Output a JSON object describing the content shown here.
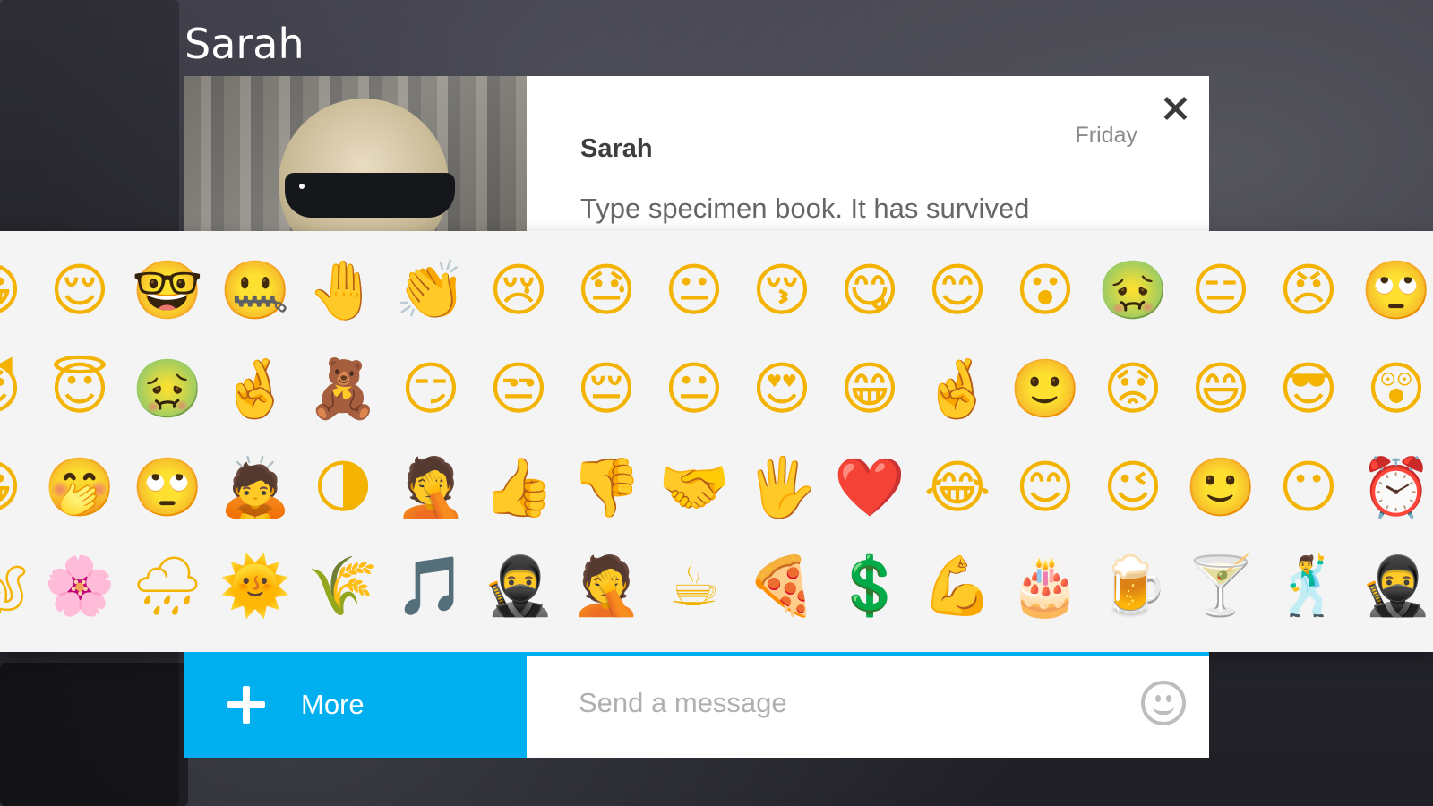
{
  "header": {
    "contact_name": "Sarah"
  },
  "conversation": {
    "sender": "Sarah",
    "time": "Friday",
    "preview_text": "Type specimen book. It has survived"
  },
  "emoji_picker": {
    "rows": [
      [
        "😀",
        "😌",
        "🤓",
        "🤐",
        "🤚",
        "👏",
        "😢",
        "😓",
        "😐",
        "😚",
        "😋",
        "😊",
        "😮",
        "🤢",
        "😑",
        "😠",
        "🙄"
      ],
      [
        "😈",
        "😇",
        "🤢",
        "🤞",
        "🧸",
        "😏",
        "😒",
        "😔",
        "😐",
        "😍",
        "😁",
        "🤞",
        "🙂",
        "😟",
        "😄",
        "😎",
        "😲"
      ],
      [
        "😀",
        "🤭",
        "🙄",
        "🙇",
        "🌗",
        "🤦",
        "👍",
        "👎",
        "🤝",
        "🖐",
        "❤️",
        "😂",
        "😊",
        "😉",
        "🙂",
        "😶",
        "⏰"
      ],
      [
        "🐿",
        "🌸",
        "🌧",
        "🌞",
        "🌾",
        "🎵",
        "🥷",
        "🤦",
        "☕",
        "🍕",
        "💲",
        "💪",
        "🎂",
        "🍺",
        "🍸",
        "🕺",
        "🥷"
      ]
    ],
    "selected": "😔"
  },
  "footer": {
    "more_label": "More",
    "message_placeholder": "Send a message"
  },
  "colors": {
    "accent": "#00aff0",
    "panel_bg": "#f4f4f4"
  }
}
